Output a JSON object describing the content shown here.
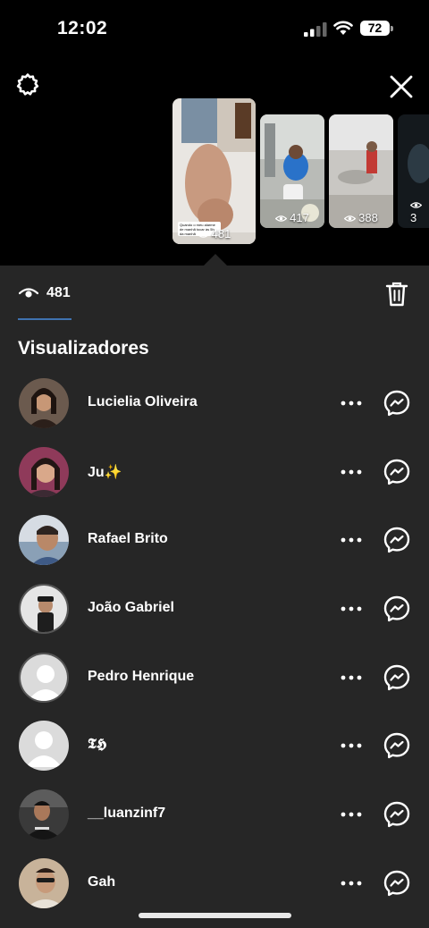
{
  "status_bar": {
    "time": "12:02",
    "battery": "72"
  },
  "stories": [
    {
      "views": "481",
      "caption": "Quando o meu alarme de manhã tocar às 5h da manhã"
    },
    {
      "views": "417"
    },
    {
      "views": "388"
    },
    {
      "views": "3"
    }
  ],
  "panel": {
    "views_count": "481",
    "section_title": "Visualizadores",
    "viewers": [
      {
        "name": "Lucielia Oliveira",
        "avatar": "photo-woman"
      },
      {
        "name": "Ju✨",
        "avatar": "photo-woman"
      },
      {
        "name": "Rafael Brito",
        "avatar": "photo-man"
      },
      {
        "name": "João Gabriel",
        "avatar": "photo-man-ring"
      },
      {
        "name": "Pedro Henrique",
        "avatar": "default-ring"
      },
      {
        "name": "𝕿𝕳",
        "avatar": "default"
      },
      {
        "name": "__luanzinf7",
        "avatar": "photo-man"
      },
      {
        "name": "Gah",
        "avatar": "photo-man"
      }
    ]
  },
  "icons": {
    "settings": "gear-icon",
    "close": "close-icon",
    "trash": "trash-icon",
    "eye": "eye-icon",
    "more": "more-horizontal-icon",
    "messenger": "messenger-icon"
  },
  "colors": {
    "background": "#000000",
    "panel": "#262626",
    "accent_underline": "#3f72b0"
  }
}
